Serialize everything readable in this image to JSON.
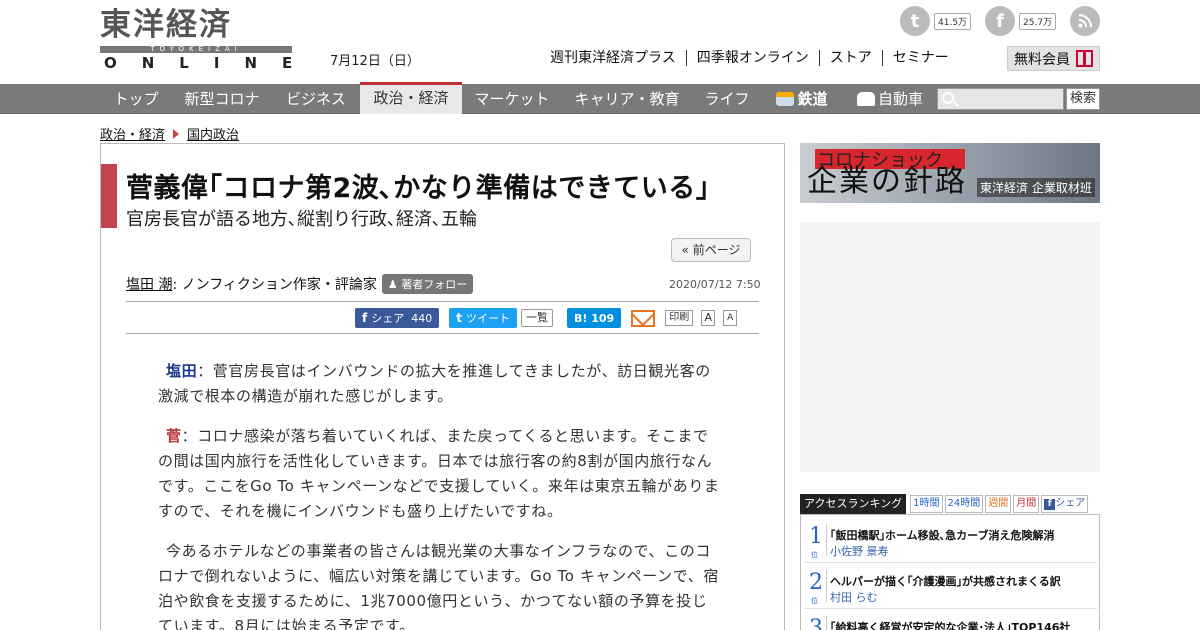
{
  "header": {
    "logo_top": "東洋経済",
    "logo_sub": "TOYOKEIZAI",
    "logo_bottom": "ONLINE",
    "date": "7月12日（日）",
    "top_links": [
      "週刊東洋経済プラス",
      "四季報オンライン",
      "ストア",
      "セミナー"
    ],
    "social": [
      {
        "icon": "twitter-icon",
        "glyph": "t",
        "count": "41.5万"
      },
      {
        "icon": "facebook-icon",
        "glyph": "f",
        "count": "25.7万"
      },
      {
        "icon": "rss-icon",
        "glyph": "",
        "count": ""
      }
    ],
    "member_button": "無料会員"
  },
  "nav": {
    "items": [
      {
        "label": "トップ",
        "active": false
      },
      {
        "label": "新型コロナ",
        "active": false
      },
      {
        "label": "ビジネス",
        "active": false
      },
      {
        "label": "政治・経済",
        "active": true
      },
      {
        "label": "マーケット",
        "active": false
      },
      {
        "label": "キャリア・教育",
        "active": false
      },
      {
        "label": "ライフ",
        "active": false
      },
      {
        "label": "鉄道",
        "active": false,
        "icon": "train-icon"
      },
      {
        "label": "自動車",
        "active": false,
        "icon": "car-icon"
      }
    ],
    "search_placeholder": "",
    "search_button": "検索"
  },
  "breadcrumb": [
    "政治・経済",
    "国内政治"
  ],
  "article": {
    "title": "菅義偉｢コロナ第2波､かなり準備はできている｣",
    "subtitle": "官房長官が語る地方､縦割り行政､経済､五輪",
    "prev_page": "« 前ページ",
    "author_name": "塩田 潮",
    "author_role": ": ノンフィクション作家・評論家",
    "follow": "著者フォロー",
    "pubdate": "2020/07/12 7:50",
    "share": {
      "facebook_label": "シェア",
      "facebook_count": "440",
      "twitter_label": "ツイート",
      "list_label": "一覧",
      "hatena_label": "B!",
      "hatena_count": "109",
      "print_label": "印刷",
      "font_large": "A",
      "font_small": "A"
    },
    "paragraphs": [
      {
        "speaker": "塩田",
        "text": "：菅官房長官はインバウンドの拡大を推進してきましたが、訪日観光客の激減で根本の構造が崩れた感じがします。"
      },
      {
        "speaker": "菅",
        "text": "：コロナ感染が落ち着いていくれば、また戻ってくると思います。そこまでの間は国内旅行を活性化していきます。日本では旅行客の約8割が国内旅行なんです。ここをGo To キャンペーンなどで支援していく。来年は東京五輪がありますので、それを機にインバウンドも盛り上げたいですね。"
      },
      {
        "speaker": "",
        "text": "今あるホテルなどの事業者の皆さんは観光業の大事なインフラなので、このコロナで倒れないように、幅広い対策を講じています。Go To キャンペーンで、宿泊や飲食を支援するために、1兆7000億円という、かつてない額の予算を投じています。8月には始まる予定です。"
      }
    ]
  },
  "sidebar": {
    "banner": {
      "line1": "コロナショック",
      "line2": "企業の針路",
      "line3": "東洋経済 企業取材班"
    },
    "ranking": {
      "title": "アクセスランキング",
      "tabs": [
        "1時間",
        "24時間",
        "週間",
        "月間",
        "シェア"
      ],
      "items": [
        {
          "rank": "1",
          "title": "｢飯田橋駅｣ホーム移設､急カーブ消え危険解消",
          "author": "小佐野 景寿"
        },
        {
          "rank": "2",
          "title": "ヘルパーが描く｢介護漫画｣が共感されまくる訳",
          "author": "村田 らむ"
        },
        {
          "rank": "3",
          "title": "｢給料高く経営が安定的な企業･法人｣TOP146社",
          "author": ""
        }
      ],
      "rank_suffix": "位"
    }
  },
  "colors": {
    "accent_red": "#c0464f",
    "nav_gray": "#7a7a7a",
    "link_blue": "#2266cc"
  }
}
